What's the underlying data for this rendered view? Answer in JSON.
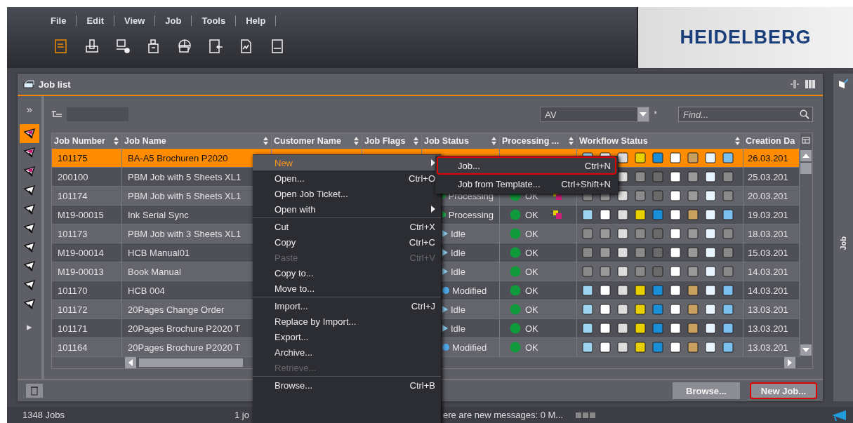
{
  "menu_bar": [
    {
      "label": "File"
    },
    {
      "label": "Edit"
    },
    {
      "label": "View"
    },
    {
      "label": "Job"
    },
    {
      "label": "Tools"
    },
    {
      "label": "Help"
    }
  ],
  "toolbar": [
    {
      "kind": "abc-doc",
      "selected": true
    },
    {
      "kind": "press",
      "selected": false
    },
    {
      "kind": "computer-gear",
      "selected": false
    },
    {
      "kind": "device",
      "selected": false
    },
    {
      "kind": "globe",
      "selected": false
    },
    {
      "kind": "import-doc",
      "selected": false
    },
    {
      "kind": "signal-doc",
      "selected": false
    },
    {
      "kind": "steps-doc",
      "selected": false
    }
  ],
  "logo": "HEIDELBERG",
  "panel": {
    "title": "Job list"
  },
  "sidebar": {
    "expand": "»",
    "items": [
      {
        "selected": true
      },
      {
        "selected": false
      },
      {
        "selected": false
      },
      {
        "selected": false
      },
      {
        "selected": false
      },
      {
        "selected": false
      },
      {
        "selected": false
      },
      {
        "selected": false
      },
      {
        "selected": false
      },
      {
        "selected": false
      }
    ],
    "more": "▸"
  },
  "filter": {
    "value": "AV",
    "asterisk": "*",
    "search_placeholder": "Find..."
  },
  "table": {
    "columns": [
      "Job Number",
      "Job Name",
      "Customer Name",
      "Job Flags",
      "Job Status",
      "Processing ...",
      "Workflow Status",
      "Creation Da"
    ],
    "rows": [
      {
        "number": "101175",
        "name": "BA-A5 Brochuren P2020",
        "selected": true,
        "kind": "hidden",
        "workflow_active": true,
        "processing_icon": false,
        "date": "26.03.201"
      },
      {
        "number": "200100",
        "name": "PBM Job with 5 Sheets XL1",
        "selected": false,
        "kind": "hidden",
        "workflow_active": false,
        "processing_icon": false,
        "date": "25.03.201"
      },
      {
        "number": "101174",
        "name": "PBM Job with 5 Sheets XL1",
        "selected": false,
        "status": "Processing",
        "kind": "processing",
        "processing": "OK",
        "workflow_active": false,
        "processing_icon": true,
        "date": "20.03.201"
      },
      {
        "number": "M19-00015",
        "name": "Ink Serial Sync",
        "selected": false,
        "status": "Processing",
        "kind": "processing",
        "processing": "OK",
        "workflow_active": true,
        "processing_icon": true,
        "date": "19.03.201"
      },
      {
        "number": "101173",
        "name": "PBM Job with 3 Sheets XL1",
        "selected": false,
        "status": "Idle",
        "kind": "idle",
        "processing": "OK",
        "workflow_active": false,
        "processing_icon": false,
        "date": "18.03.201"
      },
      {
        "number": "M19-00014",
        "name": "HCB Manual01",
        "selected": false,
        "status": "Idle",
        "kind": "idle",
        "processing": "OK",
        "workflow_active": false,
        "processing_icon": false,
        "date": "15.03.201"
      },
      {
        "number": "M19-00013",
        "name": "Book Manual",
        "selected": false,
        "status": "Idle",
        "kind": "idle",
        "processing": "OK",
        "workflow_active": false,
        "processing_icon": false,
        "date": "14.03.201"
      },
      {
        "number": "101170",
        "name": "HCB 004",
        "selected": false,
        "status": "Modified",
        "kind": "modified",
        "processing": "OK",
        "workflow_active": true,
        "processing_icon": false,
        "date": "14.03.201"
      },
      {
        "number": "101172",
        "name": "20Pages Change Order",
        "selected": false,
        "status": "Idle",
        "kind": "idle",
        "processing": "OK",
        "workflow_active": true,
        "processing_icon": false,
        "date": "13.03.201"
      },
      {
        "number": "101171",
        "name": "20Pages Brochure P2020 T",
        "selected": false,
        "status": "Idle",
        "kind": "idle",
        "processing": "OK",
        "workflow_active": true,
        "processing_icon": false,
        "date": "13.03.201"
      },
      {
        "number": "101164",
        "name": "20Pages Brochure P2020 T",
        "selected": false,
        "status": "Modified",
        "kind": "modified",
        "processing": "OK",
        "workflow_active": true,
        "processing_icon": false,
        "date": "13.03.201"
      }
    ]
  },
  "buttons": [
    {
      "label": "Browse...",
      "outlined": false
    },
    {
      "label": "New Job...",
      "outlined": true
    }
  ],
  "side_panel": {
    "label": "Job"
  },
  "status_bar": {
    "count": "1348 Jobs",
    "selection": "1 jo",
    "messages": "ere are new messages: 0 M..."
  },
  "context_menu": [
    {
      "kind": "item",
      "label": "New",
      "selected": true,
      "disabled": false,
      "submenu": true
    },
    {
      "kind": "item",
      "label": "Open...",
      "shortcut": "Ctrl+O",
      "selected": false,
      "disabled": false,
      "submenu": false
    },
    {
      "kind": "item",
      "label": "Open Job Ticket...",
      "selected": false,
      "disabled": false,
      "submenu": false
    },
    {
      "kind": "item",
      "label": "Open with",
      "selected": false,
      "disabled": false,
      "submenu": true
    },
    {
      "kind": "separator"
    },
    {
      "kind": "item",
      "label": "Cut",
      "shortcut": "Ctrl+X",
      "selected": false,
      "disabled": false,
      "submenu": false
    },
    {
      "kind": "item",
      "label": "Copy",
      "shortcut": "Ctrl+C",
      "selected": false,
      "disabled": false,
      "submenu": false
    },
    {
      "kind": "item",
      "label": "Paste",
      "shortcut": "Ctrl+V",
      "selected": false,
      "disabled": true,
      "submenu": false
    },
    {
      "kind": "item",
      "label": "Copy to...",
      "selected": false,
      "disabled": false,
      "submenu": false
    },
    {
      "kind": "item",
      "label": "Move to...",
      "selected": false,
      "disabled": false,
      "submenu": false
    },
    {
      "kind": "separator"
    },
    {
      "kind": "item",
      "label": "Import...",
      "shortcut": "Ctrl+J",
      "selected": false,
      "disabled": false,
      "submenu": false
    },
    {
      "kind": "item",
      "label": "Replace by Import...",
      "selected": false,
      "disabled": false,
      "submenu": false
    },
    {
      "kind": "item",
      "label": "Export...",
      "selected": false,
      "disabled": false,
      "submenu": false
    },
    {
      "kind": "item",
      "label": "Archive...",
      "selected": false,
      "disabled": false,
      "submenu": false
    },
    {
      "kind": "item",
      "label": "Retrieve...",
      "selected": false,
      "disabled": true,
      "submenu": false
    },
    {
      "kind": "separator"
    },
    {
      "kind": "item",
      "label": "Browse...",
      "shortcut": "Ctrl+B",
      "selected": false,
      "disabled": false,
      "submenu": false
    }
  ],
  "submenu": [
    {
      "label": "Job...",
      "shortcut": "Ctrl+N",
      "selected": true
    },
    {
      "label": "Job from Template...",
      "shortcut": "Ctrl+Shift+N",
      "selected": false
    }
  ]
}
